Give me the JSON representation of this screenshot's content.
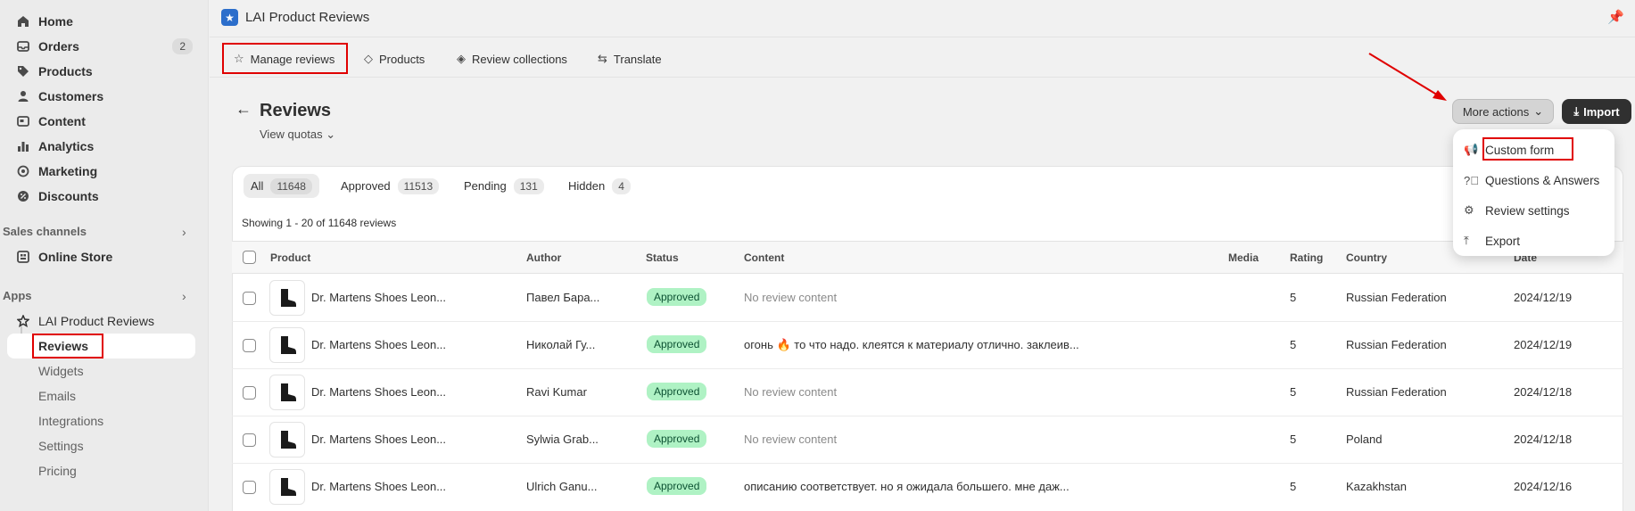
{
  "sidebar": {
    "items": [
      {
        "label": "Home",
        "icon": "home-icon"
      },
      {
        "label": "Orders",
        "icon": "orders-icon",
        "badge": "2"
      },
      {
        "label": "Products",
        "icon": "tag-icon"
      },
      {
        "label": "Customers",
        "icon": "person-icon"
      },
      {
        "label": "Content",
        "icon": "content-icon"
      },
      {
        "label": "Analytics",
        "icon": "bar-chart-icon"
      },
      {
        "label": "Marketing",
        "icon": "target-icon"
      },
      {
        "label": "Discounts",
        "icon": "discount-icon"
      }
    ],
    "sales_channels_heading": "Sales channels",
    "online_store": "Online Store",
    "apps_heading": "Apps",
    "app_name": "LAI Product Reviews",
    "app_sub_items": [
      "Reviews",
      "Widgets",
      "Emails",
      "Integrations",
      "Settings",
      "Pricing"
    ]
  },
  "appbar": {
    "title": "LAI Product Reviews"
  },
  "tabs": [
    {
      "label": "Manage reviews",
      "icon": "star-outline-icon"
    },
    {
      "label": "Products",
      "icon": "tag-icon"
    },
    {
      "label": "Review collections",
      "icon": "tags-icon"
    },
    {
      "label": "Translate",
      "icon": "translate-icon"
    }
  ],
  "page": {
    "title": "Reviews",
    "quotas_link": "View quotas",
    "more_actions": "More actions",
    "import": "Import"
  },
  "filters": [
    {
      "label": "All",
      "count": "11648",
      "active": true
    },
    {
      "label": "Approved",
      "count": "11513"
    },
    {
      "label": "Pending",
      "count": "131"
    },
    {
      "label": "Hidden",
      "count": "4"
    }
  ],
  "showing": "Showing 1 - 20 of 11648 reviews",
  "columns": [
    "Product",
    "Author",
    "Status",
    "Content",
    "Media",
    "Rating",
    "Country",
    "Date"
  ],
  "rows": [
    {
      "product": "Dr. Martens Shoes Leon...",
      "author": "Павел Бара...",
      "status": "Approved",
      "content": "No review content",
      "muted": true,
      "rating": "5",
      "country": "Russian Federation",
      "date": "2024/12/19"
    },
    {
      "product": "Dr. Martens Shoes Leon...",
      "author": "Николай Гу...",
      "status": "Approved",
      "content": "огонь 🔥 то что надо. клеятся к материалу отлично. заклеив...",
      "muted": false,
      "rating": "5",
      "country": "Russian Federation",
      "date": "2024/12/19"
    },
    {
      "product": "Dr. Martens Shoes Leon...",
      "author": "Ravi Kumar",
      "status": "Approved",
      "content": "No review content",
      "muted": true,
      "rating": "5",
      "country": "Russian Federation",
      "date": "2024/12/18"
    },
    {
      "product": "Dr. Martens Shoes Leon...",
      "author": "Sylwia Grab...",
      "status": "Approved",
      "content": "No review content",
      "muted": true,
      "rating": "5",
      "country": "Poland",
      "date": "2024/12/18"
    },
    {
      "product": "Dr. Martens Shoes Leon...",
      "author": "Ulrich Ganu...",
      "status": "Approved",
      "content": "описанию соответствует. но я ожидала большего. мне даж...",
      "muted": false,
      "rating": "5",
      "country": "Kazakhstan",
      "date": "2024/12/16"
    }
  ],
  "menu": [
    {
      "label": "Custom form",
      "icon": "megaphone-icon"
    },
    {
      "label": "Questions & Answers",
      "icon": "question-circle-icon"
    },
    {
      "label": "Review settings",
      "icon": "gear-icon"
    },
    {
      "label": "Export",
      "icon": "export-icon"
    }
  ],
  "colors": {
    "highlight": "#e00000",
    "approved_bg": "#aff2c4",
    "primary_button": "#303030"
  }
}
